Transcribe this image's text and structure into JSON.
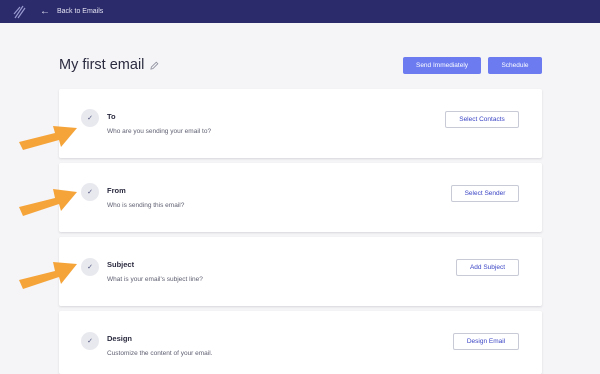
{
  "topbar": {
    "back_label": "Back to Emails"
  },
  "header": {
    "title": "My first email",
    "send_label": "Send Immediately",
    "schedule_label": "Schedule"
  },
  "sections": [
    {
      "title": "To",
      "description": "Who are you sending your email to?",
      "button": "Select Contacts"
    },
    {
      "title": "From",
      "description": "Who is sending this email?",
      "button": "Select Sender"
    },
    {
      "title": "Subject",
      "description": "What is your email's subject line?",
      "button": "Add Subject"
    },
    {
      "title": "Design",
      "description": "Customize the content of your email.",
      "button": "Design Email"
    }
  ],
  "colors": {
    "topbar": "#2b2a6b",
    "primary_button": "#6c7cf0",
    "link_text": "#3a44c4",
    "annotation_arrow": "#f5a43a"
  },
  "icons": [
    "logo-icon",
    "back-arrow-icon",
    "pencil-icon",
    "check-icon",
    "annotation-arrow"
  ]
}
